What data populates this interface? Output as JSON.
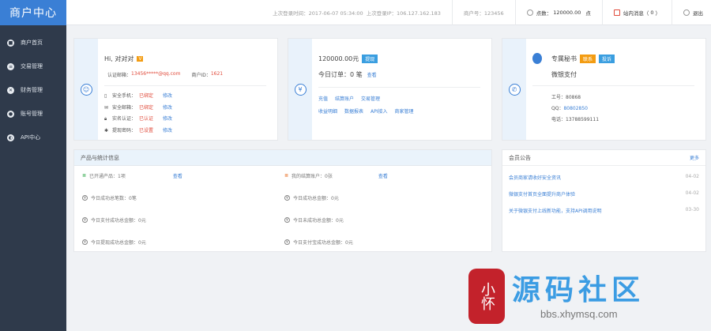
{
  "sidebar": {
    "logo": "商户中心",
    "items": [
      {
        "label": "商户首页"
      },
      {
        "label": "交易管理"
      },
      {
        "label": "财务管理"
      },
      {
        "label": "账号管理"
      },
      {
        "label": "API中心"
      }
    ]
  },
  "topbar": {
    "last_login_time": "上次登录时间：2017-06-07 05:34:00",
    "last_login_ip": "上次登录IP：106.127.162.183",
    "merchant_no": "商户号：123456",
    "points_label": "点数：",
    "points_value": "120000.00",
    "points_unit": "点",
    "message_label": "站内消息（",
    "message_count": "0",
    "message_close": "）",
    "logout": "退出"
  },
  "account": {
    "greeting": "Hi, 对对对",
    "vip": "V",
    "email_label": "认证邮箱：",
    "email_value": "13456*****@qq.com",
    "merchant_id_label": "商户ID：",
    "merchant_id_value": "1621",
    "rows": [
      {
        "label": "安全手机：",
        "status": "已绑定",
        "action": "修改"
      },
      {
        "label": "安全邮箱：",
        "status": "已绑定",
        "action": "修改"
      },
      {
        "label": "实名认证：",
        "status": "已认证",
        "action": "修改"
      },
      {
        "label": "提现密码：",
        "status": "已设置",
        "action": "修改"
      }
    ]
  },
  "balance": {
    "amount": "120000.00元",
    "withdraw": "提现",
    "today_orders": "今日订单：0 笔",
    "view": "查看",
    "links_row1": [
      "充值",
      "结算账户",
      "交易管理"
    ],
    "links_row2": [
      "收益明细",
      "数据报表",
      "API接入",
      "商家管理"
    ]
  },
  "secretary": {
    "title": "专属秘书",
    "contact": "联系",
    "complain": "投诉",
    "name": "微银支付",
    "id_label": "工号：",
    "id_value": "80868",
    "qq_label": "QQ：",
    "qq_value": "80802850",
    "phone_label": "电话：",
    "phone_value": "13788599111"
  },
  "stats": {
    "title": "产品与统计信息",
    "items": [
      {
        "label": "已开通产品：",
        "value": "1项",
        "link": "查看"
      },
      {
        "label": "我的结算账户：",
        "value": "0张",
        "link": "查看"
      },
      {
        "label": "今日成功总笔数：",
        "value": "0笔"
      },
      {
        "label": "今日成功总金额：",
        "value": "0元"
      },
      {
        "label": "今日支付成功总金额：",
        "value": "0元"
      },
      {
        "label": "今日未成功总金额：",
        "value": "0元"
      },
      {
        "label": "今日提现成功总金额：",
        "value": "0元"
      },
      {
        "label": "今日支付宝成功总金额：",
        "value": "0元"
      }
    ]
  },
  "news": {
    "title": "会员公告",
    "more": "更多",
    "items": [
      {
        "text": "会员商家请收好安全资讯",
        "date": "04-02"
      },
      {
        "text": "微银支付首页全面提升商户体验",
        "date": "04-02"
      },
      {
        "text": "关于微银支付上线新功能，支持API调用说明",
        "date": "03-30"
      }
    ]
  },
  "watermark": {
    "seal": "小怀",
    "title": "源码社区",
    "url": "bbs.xhymsq.com"
  }
}
